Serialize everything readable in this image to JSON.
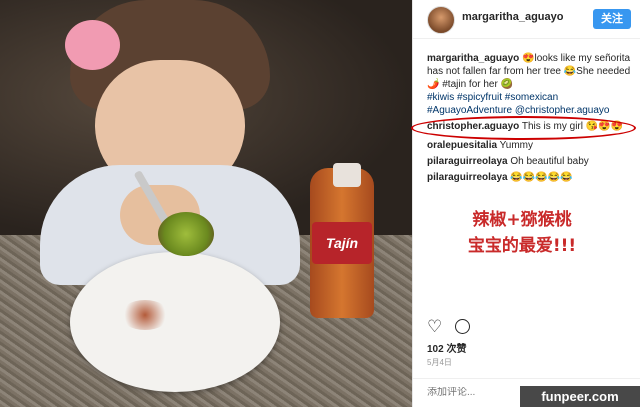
{
  "header": {
    "username": "margaritha_aguayo",
    "follow_label": "关注"
  },
  "comments": [
    {
      "user": "margaritha_aguayo",
      "text": "😍looks like my señorita has not fallen far from her tree 😂She needed 🌶️ #tajin for her 🥝"
    },
    {
      "hashtags": "#kiwis #spicyfruit #somexican",
      "extra": "#AguayoAdventure @christopher.aguayo"
    },
    {
      "user": "christopher.aguayo",
      "text": "This is my girl 😘😍😍"
    },
    {
      "user": "oralepuesitalia",
      "text": "Yummy"
    },
    {
      "user": "pilaraguirreolaya",
      "text": "Oh beautiful baby"
    },
    {
      "user": "pilaraguirreolaya",
      "text": "😂😂😂😂😂"
    }
  ],
  "overlay_text": {
    "line1": "辣椒+猕猴桃",
    "line2": "宝宝的最爱!!!"
  },
  "photo": {
    "bottle_label": "Tajín"
  },
  "stats": {
    "likes": "102 次赞",
    "date": "5月4日"
  },
  "add_comment_placeholder": "添加评论...",
  "watermark": "funpeer.com",
  "colors": {
    "follow_button": "#3897f0",
    "highlight_circle": "#cc0000",
    "overlay_text": "#c92a2a"
  }
}
